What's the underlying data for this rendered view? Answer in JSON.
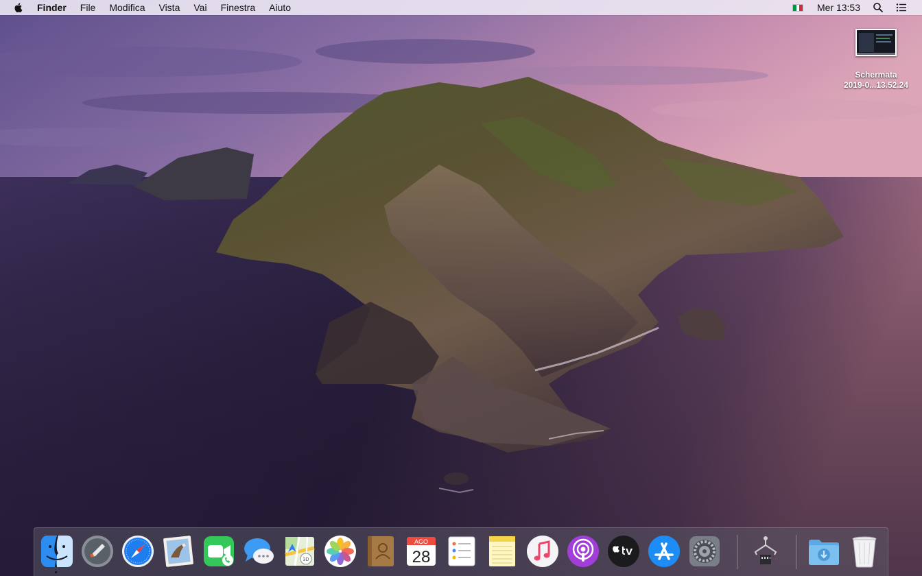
{
  "menubar": {
    "app_name": "Finder",
    "items": [
      "File",
      "Modifica",
      "Vista",
      "Vai",
      "Finestra",
      "Aiuto"
    ],
    "clock": "Mer 13:53",
    "flag_colors": [
      "#009246",
      "#ffffff",
      "#ce2b37"
    ]
  },
  "desktop": {
    "file": {
      "name_line1": "Schermata",
      "name_line2": "2019-0...13.52.24"
    }
  },
  "dock": {
    "apps": [
      "finder-icon",
      "launchpad-icon",
      "safari-icon",
      "mail-icon",
      "facetime-icon",
      "messages-icon",
      "maps-icon",
      "photos-icon",
      "contacts-icon",
      "calendar-icon",
      "reminders-icon",
      "notes-icon",
      "music-icon",
      "podcasts-icon",
      "apple-tv-icon",
      "app-store-icon",
      "system-preferences-icon",
      "usb-utility-icon",
      "downloads-folder-icon",
      "trash-icon"
    ],
    "calendar": {
      "month": "AGO",
      "day": "28"
    },
    "maps_badge": "3D"
  }
}
